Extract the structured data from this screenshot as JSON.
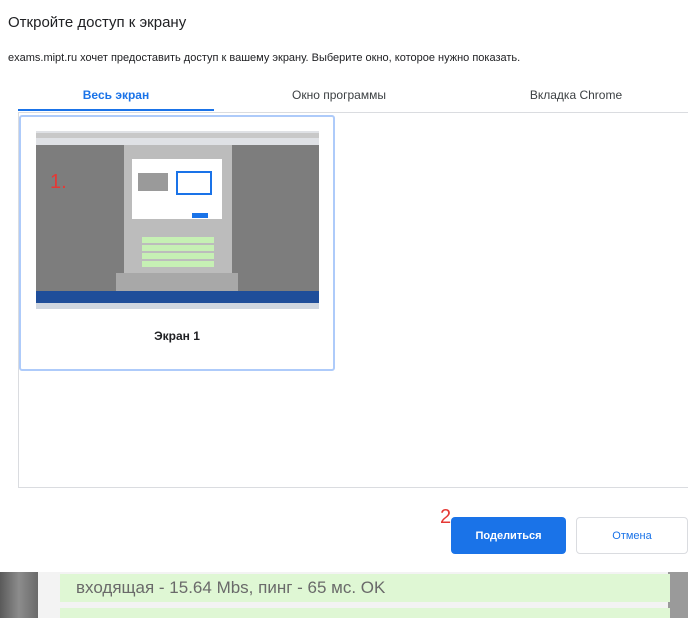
{
  "dialog": {
    "title": "Откройте доступ к экрану",
    "subtitle": "exams.mipt.ru хочет предоставить доступ к вашему экрану. Выберите окно, которое нужно показать."
  },
  "tabs": [
    {
      "label": "Весь экран",
      "active": true
    },
    {
      "label": "Окно программы",
      "active": false
    },
    {
      "label": "Вкладка Chrome",
      "active": false
    }
  ],
  "screens": [
    {
      "name": "Экран 1",
      "annotation": "1."
    }
  ],
  "buttons": {
    "annotation": "2.",
    "share": "Поделиться",
    "cancel": "Отмена"
  },
  "background_page": {
    "row_text": "входящая - 15.64 Mbs, пинг - 65 мс. OK"
  },
  "colors": {
    "accent": "#1a73e8",
    "annotation_red": "#e53935",
    "selected_border": "#aecbfa",
    "success_bg": "#dff7d4"
  }
}
